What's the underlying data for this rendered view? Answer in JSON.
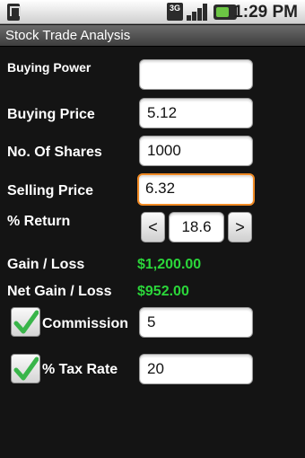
{
  "status_bar": {
    "time": "1:29 PM",
    "network_label": "3G",
    "icons": [
      "notification-icon",
      "network-3g-icon",
      "signal-icon",
      "battery-icon"
    ]
  },
  "app": {
    "title": "Stock Trade Analysis"
  },
  "form": {
    "buying_power": {
      "label": "Buying Power",
      "value": ""
    },
    "buying_price": {
      "label": "Buying Price",
      "value": "5.12"
    },
    "num_shares": {
      "label": "No. Of Shares",
      "value": "1000"
    },
    "selling_price": {
      "label": "Selling Price",
      "value": "6.32"
    },
    "percent_return": {
      "label": "% Return",
      "value": "18.6",
      "decrement": "<",
      "increment": ">"
    },
    "gain_loss": {
      "label": "Gain / Loss",
      "value": "$1,200.00"
    },
    "net_gain_loss": {
      "label": "Net Gain / Loss",
      "value": "$952.00"
    },
    "commission": {
      "label": "Commission",
      "value": "5",
      "checked": true
    },
    "tax_rate": {
      "label": "% Tax Rate",
      "value": "20",
      "checked": true
    }
  },
  "colors": {
    "accent_focus": "#f08a24",
    "gain_green": "#2bd63a",
    "check_green": "#39b54a"
  }
}
